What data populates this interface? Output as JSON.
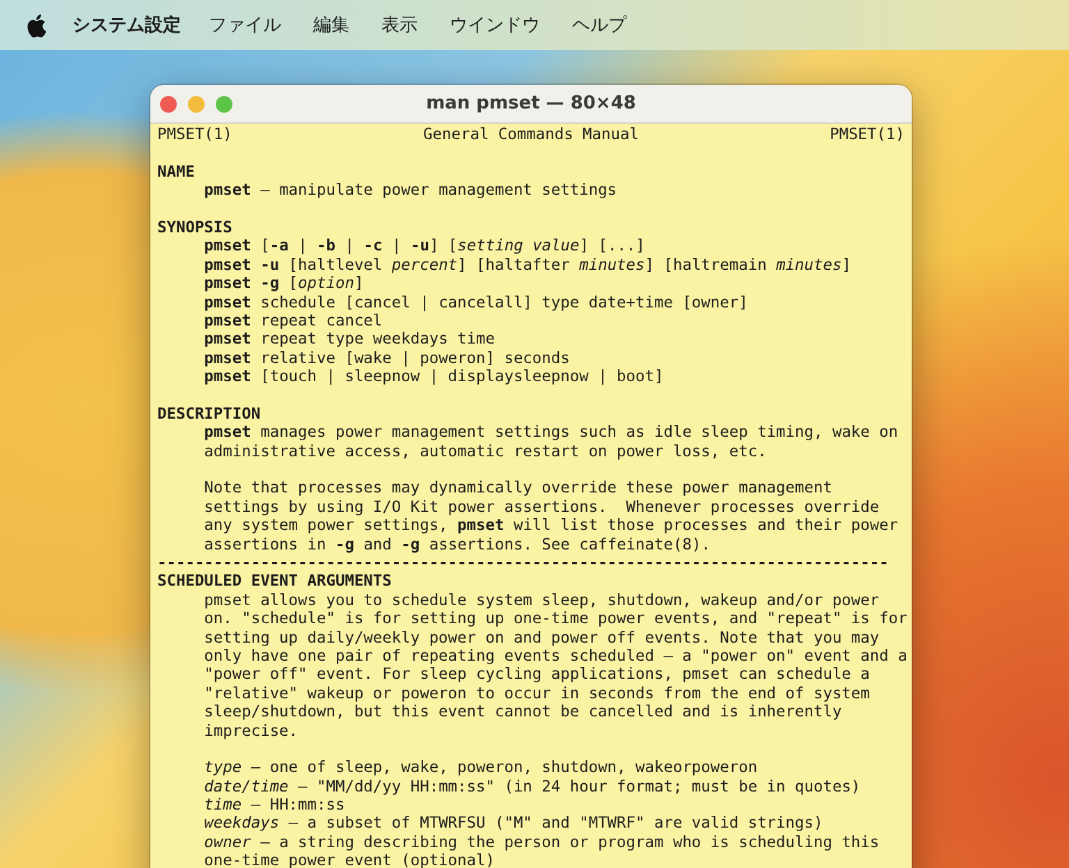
{
  "menu_bar": {
    "app_name": "システム設定",
    "menus": [
      "ファイル",
      "編集",
      "表示",
      "ウインドウ",
      "ヘルプ"
    ]
  },
  "window": {
    "title": "man pmset — 80×48"
  },
  "header": {
    "left": "PMSET(1)",
    "center": "General Commands Manual",
    "right": "PMSET(1)"
  },
  "lines": [
    {
      "kind": "blank"
    },
    {
      "kind": "heading",
      "text": "NAME"
    },
    {
      "kind": "body",
      "text": "**pmset** – manipulate power management settings"
    },
    {
      "kind": "blank"
    },
    {
      "kind": "heading",
      "text": "SYNOPSIS"
    },
    {
      "kind": "body",
      "text": "**pmset** [**-a** | **-b** | **-c** | **-u**] [*setting* *value*] [...]"
    },
    {
      "kind": "body",
      "text": "**pmset -u** [haltlevel *percent*] [haltafter *minutes*] [haltremain *minutes*]"
    },
    {
      "kind": "body",
      "text": "**pmset -g** [*option*]"
    },
    {
      "kind": "body",
      "text": "**pmset** schedule [cancel | cancelall] type date+time [owner]"
    },
    {
      "kind": "body",
      "text": "**pmset** repeat cancel"
    },
    {
      "kind": "body",
      "text": "**pmset** repeat type weekdays time"
    },
    {
      "kind": "body",
      "text": "**pmset** relative [wake | poweron] seconds"
    },
    {
      "kind": "body",
      "text": "**pmset** [touch | sleepnow | displaysleepnow | boot]"
    },
    {
      "kind": "blank"
    },
    {
      "kind": "heading",
      "text": "DESCRIPTION"
    },
    {
      "kind": "body",
      "text": "**pmset** manages power management settings such as idle sleep timing, wake on"
    },
    {
      "kind": "body",
      "text": "administrative access, automatic restart on power loss, etc."
    },
    {
      "kind": "blank"
    },
    {
      "kind": "body",
      "text": "Note that processes may dynamically override these power management"
    },
    {
      "kind": "body",
      "text": "settings by using I/O Kit power assertions.  Whenever processes override"
    },
    {
      "kind": "body",
      "text": "any system power settings, **pmset** will list those processes and their power"
    },
    {
      "kind": "body",
      "text": "assertions in **-g** and **-g** assertions. See caffeinate(8)."
    },
    {
      "kind": "rule",
      "text": "------------------------------------------------------------------------------"
    },
    {
      "kind": "heading",
      "text": "SCHEDULED EVENT ARGUMENTS"
    },
    {
      "kind": "body",
      "text": "pmset allows you to schedule system sleep, shutdown, wakeup and/or power"
    },
    {
      "kind": "body",
      "text": "on. \"schedule\" is for setting up one-time power events, and \"repeat\" is for"
    },
    {
      "kind": "body",
      "text": "setting up daily/weekly power on and power off events. Note that you may"
    },
    {
      "kind": "body",
      "text": "only have one pair of repeating events scheduled – a \"power on\" event and a"
    },
    {
      "kind": "body",
      "text": "\"power off\" event. For sleep cycling applications, pmset can schedule a"
    },
    {
      "kind": "body",
      "text": "\"relative\" wakeup or poweron to occur in seconds from the end of system"
    },
    {
      "kind": "body",
      "text": "sleep/shutdown, but this event cannot be cancelled and is inherently"
    },
    {
      "kind": "body",
      "text": "imprecise."
    },
    {
      "kind": "blank"
    },
    {
      "kind": "body",
      "text": "*type* – one of sleep, wake, poweron, shutdown, wakeorpoweron"
    },
    {
      "kind": "body",
      "text": "*date/time* – \"MM/dd/yy HH:mm:ss\" (in 24 hour format; must be in quotes)"
    },
    {
      "kind": "body",
      "text": "*time* – HH:mm:ss"
    },
    {
      "kind": "body",
      "text": "*weekdays* – a subset of MTWRFSU (\"M\" and \"MTWRF\" are valid strings)"
    },
    {
      "kind": "body",
      "text": "*owner* – a string describing the person or program who is scheduling this"
    },
    {
      "kind": "body",
      "text": "one-time power event (optional)"
    }
  ]
}
